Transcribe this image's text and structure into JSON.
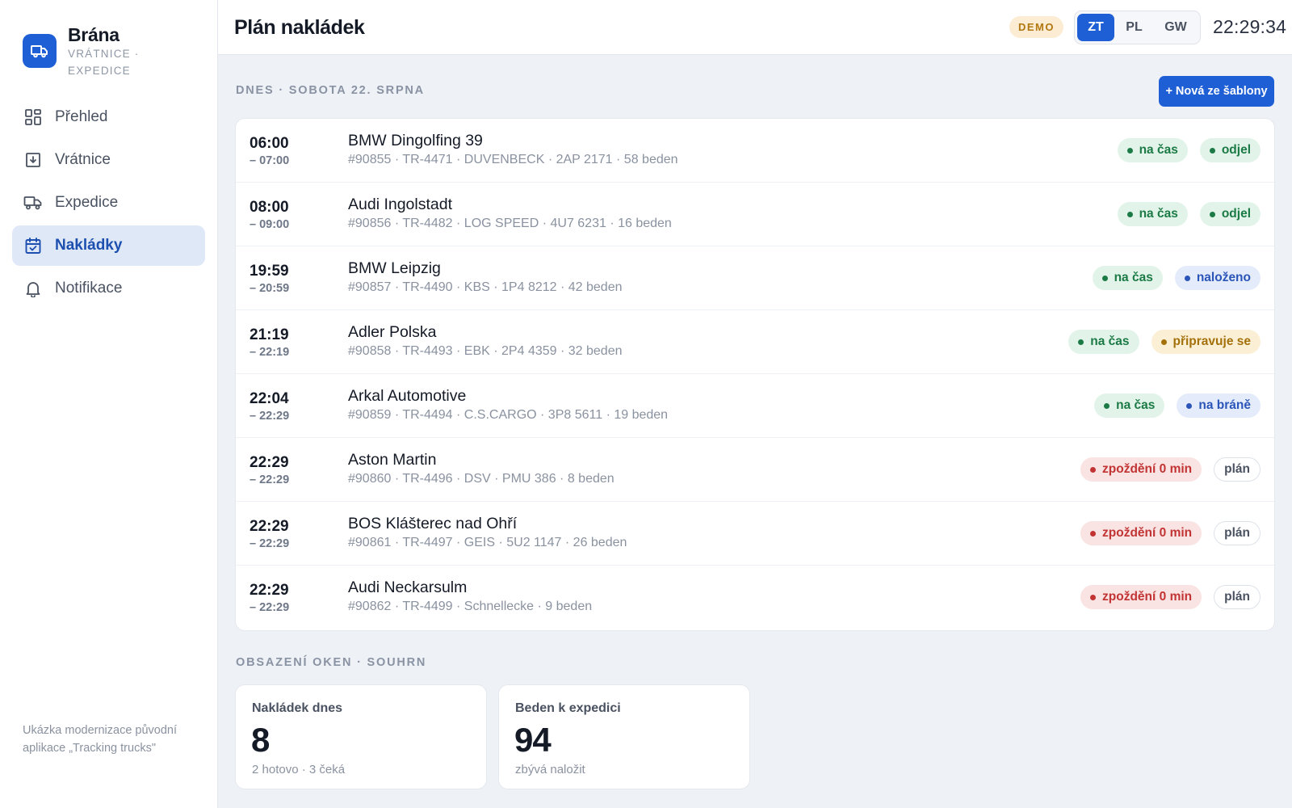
{
  "app": {
    "name": "Brána",
    "subtitle": "VRÁTNICE · EXPEDICE",
    "footer_note": "Ukázka modernizace původní aplikace „Tracking trucks\""
  },
  "sidebar": {
    "items": [
      {
        "label": "Přehled",
        "icon": "grid-icon",
        "active": false
      },
      {
        "label": "Vrátnice",
        "icon": "gate-icon",
        "active": false
      },
      {
        "label": "Expedice",
        "icon": "truck-icon",
        "active": false
      },
      {
        "label": "Nakládky",
        "icon": "calendar-check-icon",
        "active": true
      },
      {
        "label": "Notifikace",
        "icon": "bell-icon",
        "active": false
      }
    ]
  },
  "header": {
    "title": "Plán nakládek",
    "demo_badge": "DEMO",
    "segments": [
      {
        "label": "ZT",
        "active": true
      },
      {
        "label": "PL",
        "active": false
      },
      {
        "label": "GW",
        "active": false
      }
    ],
    "clock": "22:29:34"
  },
  "main": {
    "day_label": "DNES · SOBOTA 22. SRPNA",
    "new_button": "+ Nová ze šablony",
    "loadings": [
      {
        "start": "06:00",
        "end": "– 07:00",
        "name": "BMW Dingolfing 39",
        "meta": "#90855 · TR-4471 · DUVENBECK · 2AP 2171 · 58 beden",
        "badges": [
          {
            "text": "na čas",
            "tone": "green",
            "dot": true
          },
          {
            "text": "odjel",
            "tone": "green",
            "dot": true
          }
        ]
      },
      {
        "start": "08:00",
        "end": "– 09:00",
        "name": "Audi Ingolstadt",
        "meta": "#90856 · TR-4482 · LOG SPEED · 4U7 6231 · 16 beden",
        "badges": [
          {
            "text": "na čas",
            "tone": "green",
            "dot": true
          },
          {
            "text": "odjel",
            "tone": "green",
            "dot": true
          }
        ]
      },
      {
        "start": "19:59",
        "end": "– 20:59",
        "name": "BMW Leipzig",
        "meta": "#90857 · TR-4490 · KBS · 1P4 8212 · 42 beden",
        "badges": [
          {
            "text": "na čas",
            "tone": "green",
            "dot": true
          },
          {
            "text": "naloženo",
            "tone": "blue",
            "dot": true
          }
        ]
      },
      {
        "start": "21:19",
        "end": "– 22:19",
        "name": "Adler Polska",
        "meta": "#90858 · TR-4493 · EBK · 2P4 4359 · 32 beden",
        "badges": [
          {
            "text": "na čas",
            "tone": "green",
            "dot": true
          },
          {
            "text": "připravuje se",
            "tone": "amber",
            "dot": true
          }
        ]
      },
      {
        "start": "22:04",
        "end": "– 22:29",
        "name": "Arkal Automotive",
        "meta": "#90859 · TR-4494 · C.S.CARGO · 3P8 5611 · 19 beden",
        "badges": [
          {
            "text": "na čas",
            "tone": "green",
            "dot": true
          },
          {
            "text": "na bráně",
            "tone": "blue",
            "dot": true
          }
        ]
      },
      {
        "start": "22:29",
        "end": "– 22:29",
        "name": "Aston Martin",
        "meta": "#90860 · TR-4496 · DSV · PMU 386 · 8 beden",
        "badges": [
          {
            "text": "zpoždění 0 min",
            "tone": "red",
            "dot": true
          },
          {
            "text": "plán",
            "tone": "plain",
            "dot": false
          }
        ]
      },
      {
        "start": "22:29",
        "end": "– 22:29",
        "name": "BOS Klášterec nad Ohří",
        "meta": "#90861 · TR-4497 · GEIS · 5U2 1147 · 26 beden",
        "badges": [
          {
            "text": "zpoždění 0 min",
            "tone": "red",
            "dot": true
          },
          {
            "text": "plán",
            "tone": "plain",
            "dot": false
          }
        ]
      },
      {
        "start": "22:29",
        "end": "– 22:29",
        "name": "Audi Neckarsulm",
        "meta": "#90862 · TR-4499 · Schnellecke · 9 beden",
        "badges": [
          {
            "text": "zpoždění 0 min",
            "tone": "red",
            "dot": true
          },
          {
            "text": "plán",
            "tone": "plain",
            "dot": false
          }
        ]
      }
    ],
    "summary_label": "OBSAZENÍ OKEN · SOUHRN",
    "stats": [
      {
        "label": "Nakládek dnes",
        "value": "8",
        "sub": "2 hotovo · 3 čeká"
      },
      {
        "label": "Beden k expedici",
        "value": "94",
        "sub": "zbývá naložit"
      }
    ]
  },
  "colors": {
    "accent": "#1f5fd6",
    "green": "#1b7a45",
    "blue": "#2b55b8",
    "amber": "#a4700a",
    "red": "#c23434"
  }
}
